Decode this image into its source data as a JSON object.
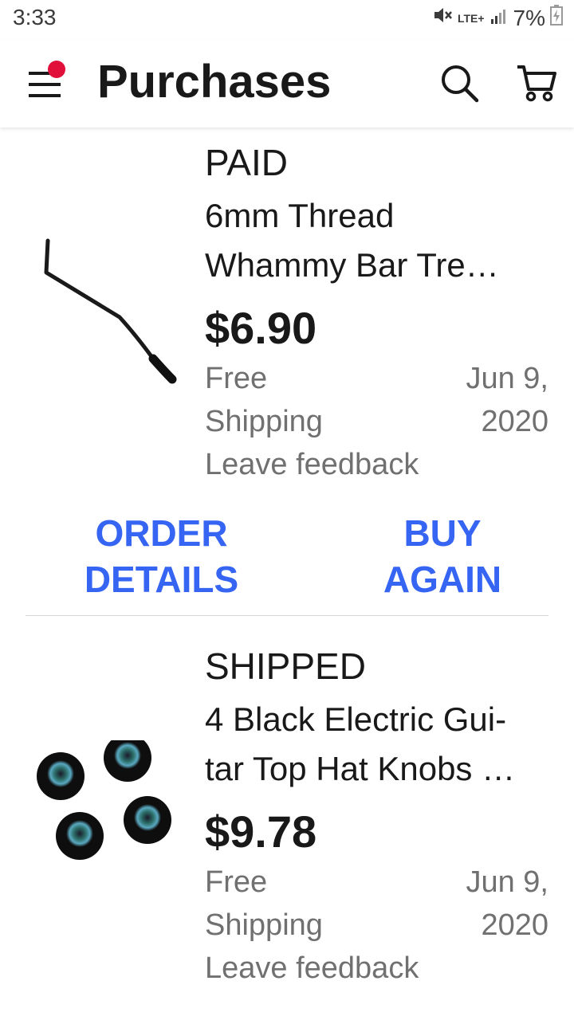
{
  "status_bar": {
    "time": "3:33",
    "network": "LTE+",
    "battery": "7%"
  },
  "app_bar": {
    "title": "Purchases",
    "menu_icon": "hamburger-menu-icon",
    "notification_dot_color": "#e0103a",
    "search_icon": "search-icon",
    "cart_icon": "cart-icon"
  },
  "orders": [
    {
      "status": "PAID",
      "title_line1": "6mm Thread",
      "title_line2": "Whammy Bar Tre…",
      "price": "$6.90",
      "shipping_line1": "Free",
      "shipping_line2": "Shipping",
      "date_line1": "Jun 9,",
      "date_line2": "2020",
      "feedback": "Leave feedback",
      "image": "whammy-bar-image",
      "actions": {
        "order_details_line1": "ORDER",
        "order_details_line2": "DETAILS",
        "buy_again_line1": "BUY",
        "buy_again_line2": "AGAIN"
      }
    },
    {
      "status": "SHIPPED",
      "title_line1": "4 Black Electric Gui-",
      "title_line2": "tar Top Hat Knobs …",
      "price": "$9.78",
      "shipping_line1": "Free",
      "shipping_line2": "Shipping",
      "date_line1": "Jun 9,",
      "date_line2": "2020",
      "feedback": "Leave feedback",
      "image": "guitar-knobs-image"
    }
  ],
  "colors": {
    "accent": "#3665f3",
    "text_primary": "#191919",
    "text_secondary": "#707070",
    "divider": "#d6d6d6"
  }
}
